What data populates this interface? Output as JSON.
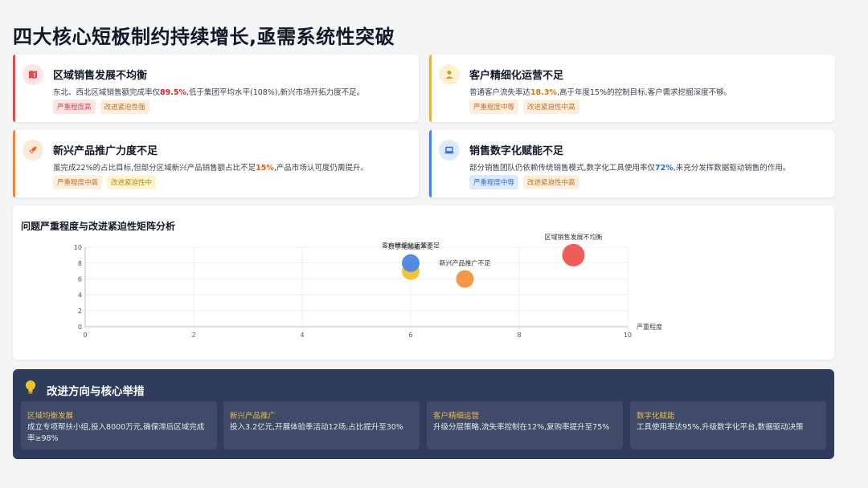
{
  "page": {
    "title": "四大核心短板制约持续增长,亟需系统性突破"
  },
  "cards": [
    {
      "title": "区域销售发展不均衡",
      "desc_pre": "东北、西北区域销售额完成率仅",
      "desc_hl": "89.5%",
      "desc_post": ",低于集团平均水平(108%),新兴市场开拓力度不足。",
      "tag1": "严重程度高",
      "tag2": "改进紧迫性强",
      "icon": "map-alert-icon",
      "accent": "#e5484d"
    },
    {
      "title": "客户精细化运营不足",
      "desc_pre": "普通客户流失率达",
      "desc_hl": "18.3%",
      "desc_post": ",高于年度15%的控制目标,客户需求挖掘深度不够。",
      "tag1": "严重程度中等",
      "tag2": "改进紧迫性中高",
      "icon": "user-icon",
      "accent": "#e8b62b"
    },
    {
      "title": "新兴产品推广力度不足",
      "desc_pre": "虽完成22%的占比目标,但部分区域新兴产品销售额占比不足",
      "desc_hl": "15%",
      "desc_post": ",产品市场认可度仍需提升。",
      "tag1": "严重程度中高",
      "tag2": "改进紧迫性中",
      "icon": "rocket-icon",
      "accent": "#f28a2c"
    },
    {
      "title": "销售数字化赋能不足",
      "desc_pre": "部分销售团队仍依赖传统销售模式,数字化工具使用率仅",
      "desc_hl": "72%",
      "desc_post": ",未充分发挥数据驱动销售的作用。",
      "tag1": "严重程度中等",
      "tag2": "改进紧迫性中高",
      "icon": "laptop-icon",
      "accent": "#3b82f6"
    }
  ],
  "chart_title": "问题严重程度与改进紧迫性矩阵分析",
  "chart_data": {
    "type": "scatter",
    "xlabel": "严重程度",
    "ylabel": "",
    "xlim": [
      0,
      10
    ],
    "ylim": [
      0,
      10
    ],
    "xticks": [
      0,
      2,
      4,
      6,
      8,
      10
    ],
    "yticks": [
      0,
      2,
      4,
      6,
      8,
      10
    ],
    "grid": true,
    "points": [
      {
        "label": "区域销售发展不均衡",
        "x": 9,
        "y": 9,
        "color": "#ef5350"
      },
      {
        "label": "客户精细化运营不足",
        "x": 6,
        "y": 7,
        "color": "#f2c12e"
      },
      {
        "label": "新兴产品推广不足",
        "x": 7,
        "y": 6,
        "color": "#f7913a"
      },
      {
        "label": "数字化赋能不足",
        "x": 6,
        "y": 8,
        "color": "#4a86e8"
      }
    ]
  },
  "bottom": {
    "title": "改进方向与核心举措",
    "items": [
      {
        "head": "区域均衡发展",
        "body": "成立专项帮扶小组,投入8000万元,确保滞后区域完成率≥98%"
      },
      {
        "head": "新兴产品推广",
        "body": "投入3.2亿元,开展体验季活动12场,占比提升至30%"
      },
      {
        "head": "客户精细运营",
        "body": "升级分层策略,流失率控制在12%,复购率提升至75%"
      },
      {
        "head": "数字化赋能",
        "body": "工具使用率达95%,升级数字化平台,数据驱动决策"
      }
    ]
  }
}
